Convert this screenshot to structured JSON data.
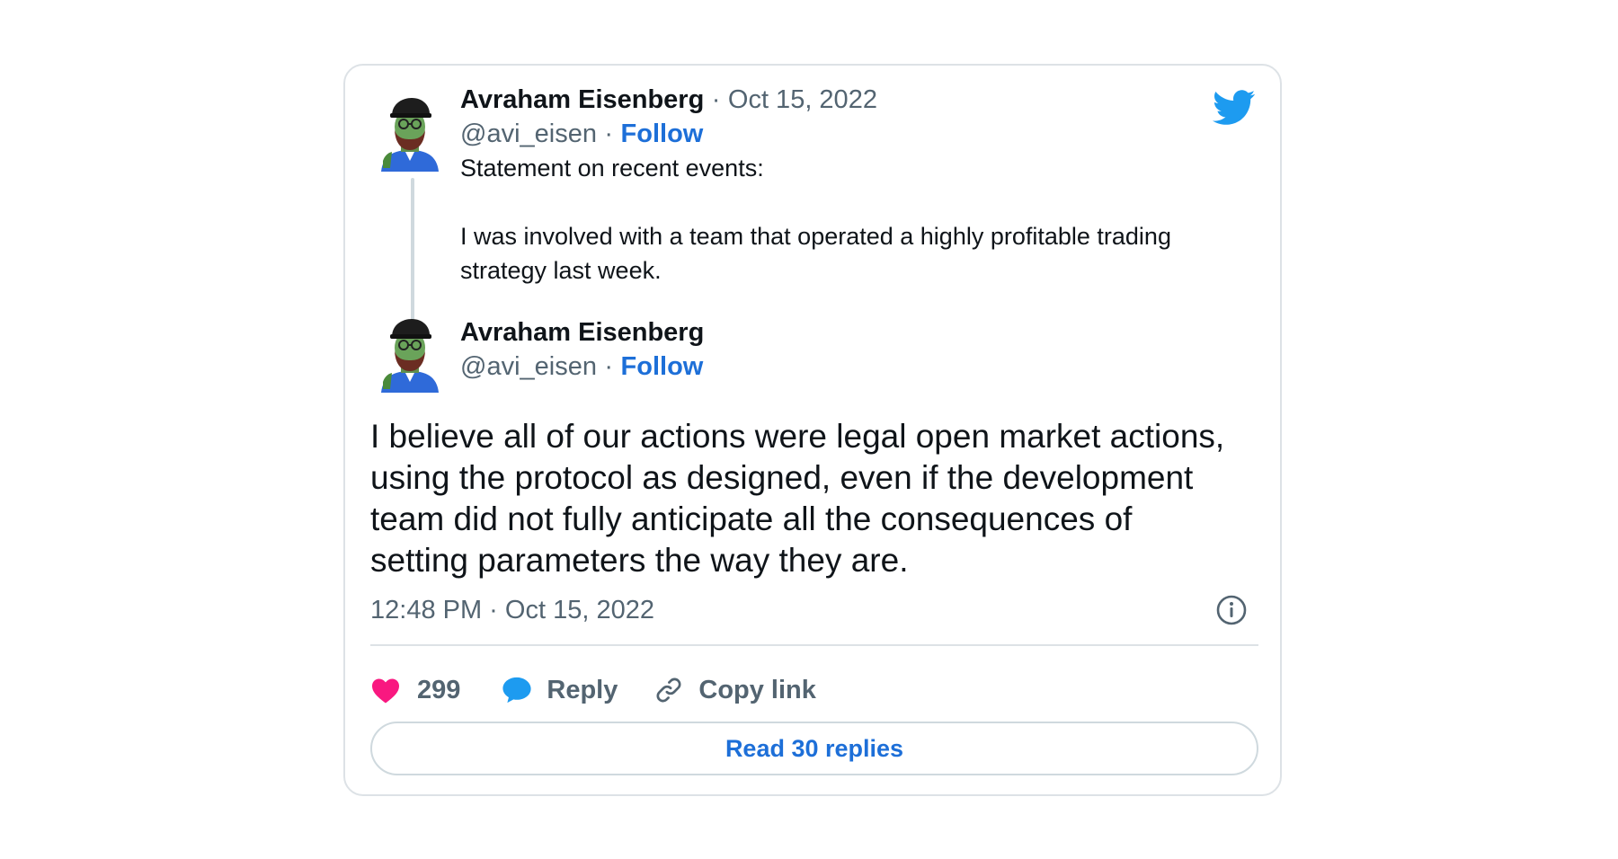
{
  "quoted_tweet": {
    "author_name": "Avraham Eisenberg",
    "separator": "·",
    "date": "Oct 15, 2022",
    "handle": "@avi_eisen",
    "follow_label": "Follow",
    "text_line1": "Statement on recent events:",
    "text_line2": "I was involved with a team that operated a highly profitable trading",
    "text_line3": "strategy last week.",
    "avatar_icon": "avatar-illustration-icon"
  },
  "main_tweet": {
    "author_name": "Avraham Eisenberg",
    "handle": "@avi_eisen",
    "separator": "·",
    "follow_label": "Follow",
    "text_lines": [
      "I believe all of our actions were legal open market actions,",
      "using the protocol as designed, even if the development",
      "team did not fully anticipate all the consequences of",
      "setting parameters the way they are."
    ],
    "timestamp": "12:48 PM · Oct 15, 2022",
    "avatar_icon": "avatar-illustration-icon"
  },
  "actions": {
    "like_count": "299",
    "reply_label": "Reply",
    "copy_link_label": "Copy link"
  },
  "read_replies_label": "Read 30 replies",
  "icons": {
    "brand": "twitter-bird-icon",
    "info": "info-icon",
    "like": "heart-icon",
    "reply": "speech-bubble-icon",
    "copy": "link-icon"
  },
  "colors": {
    "brand_blue": "#1d9bf0",
    "link_blue": "#1d6fd8",
    "like_pink": "#f91880",
    "muted_text": "#536471",
    "border": "#dde2e6"
  }
}
